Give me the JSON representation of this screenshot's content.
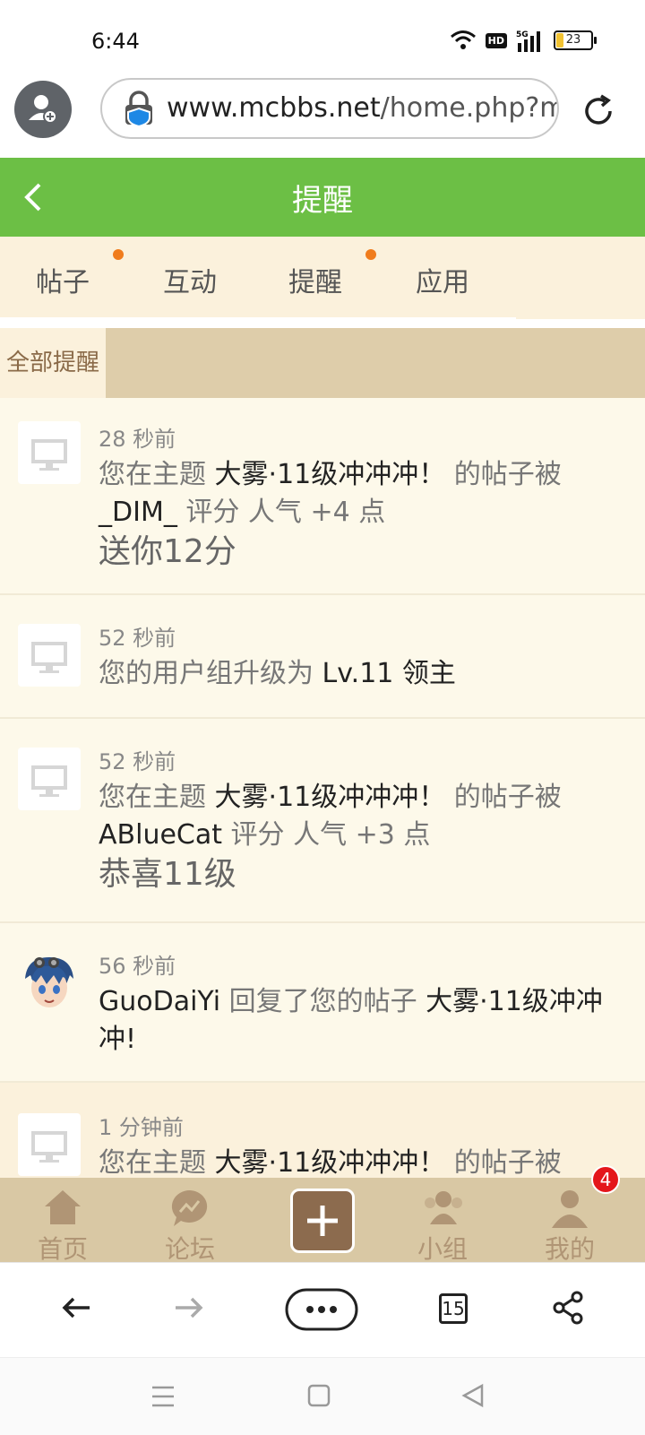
{
  "status_bar": {
    "time": "6:44",
    "hd": "HD",
    "network": "5G",
    "battery": "23"
  },
  "browser": {
    "url_host": "www.mcbbs.net",
    "url_rest": "/home.php?m",
    "tab_count": "15"
  },
  "header": {
    "title": "提醒"
  },
  "tabs": [
    {
      "label": "帖子",
      "has_dot": true
    },
    {
      "label": "互动",
      "has_dot": false
    },
    {
      "label": "提醒",
      "has_dot": true
    },
    {
      "label": "应用",
      "has_dot": false
    }
  ],
  "filter": {
    "label": "全部提醒"
  },
  "notifications": [
    {
      "time": "28 秒前",
      "line1_a": "您在主题 ",
      "line1_b": "大雾·11级冲冲冲！",
      "line1_c": " 的帖子被",
      "line2_a": "_DIM_",
      "line2_b": " 评分 人气 +4 点",
      "note": "送你12分"
    },
    {
      "time": "52 秒前",
      "line1_a": "您的用户组升级为 ",
      "line1_b": "Lv.11 领主"
    },
    {
      "time": "52 秒前",
      "line1_a": "您在主题 ",
      "line1_b": "大雾·11级冲冲冲！",
      "line1_c": " 的帖子被",
      "line2_a": "ABlueCat",
      "line2_b": " 评分 人气 +3 点",
      "note": "恭喜11级"
    },
    {
      "time": "56 秒前",
      "line1_a": "GuoDaiYi",
      "line1_b": " 回复了您的帖子 ",
      "line1_c": "大雾·11级冲冲",
      "line2_a": "冲!"
    },
    {
      "time": "1 分钟前",
      "line1_a": "您在主题 ",
      "line1_b": "大雾·11级冲冲冲！",
      "line1_c": " 的帖子被"
    }
  ],
  "bottom_nav": [
    {
      "label": "首页"
    },
    {
      "label": "论坛"
    },
    {
      "label": ""
    },
    {
      "label": "小组"
    },
    {
      "label": "我的",
      "badge": "4"
    }
  ],
  "colors": {
    "header_green": "#6cbf45",
    "tab_bg": "#fbf1dc",
    "accent_dot": "#f07c1c",
    "nav_bg": "#d9c8a4",
    "badge_red": "#e4161b"
  }
}
